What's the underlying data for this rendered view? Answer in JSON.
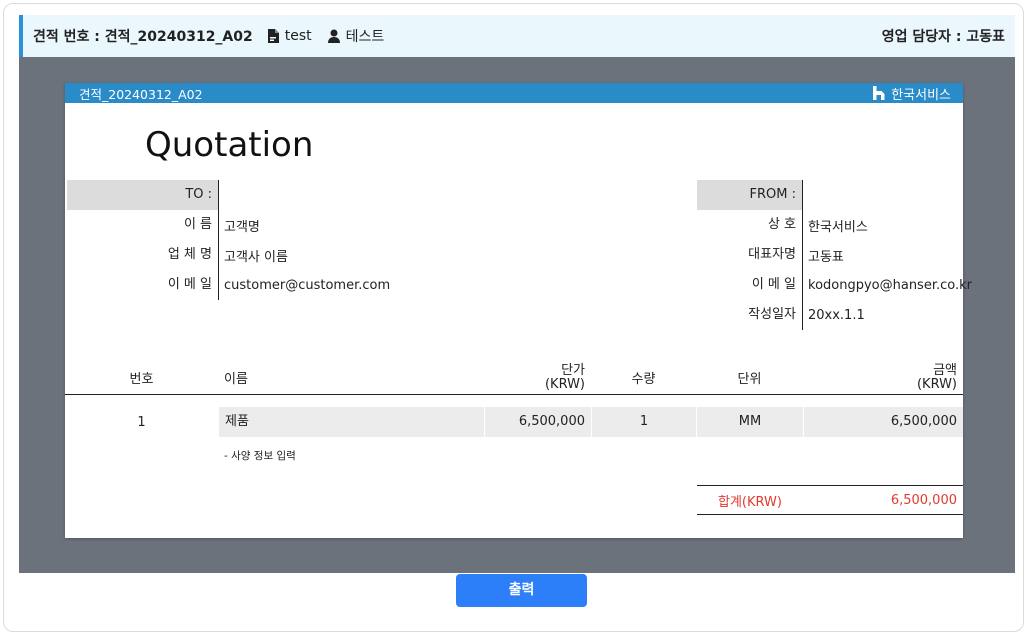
{
  "header": {
    "title": "견적 번호 : 견적_20240312_A02",
    "file_label": "test",
    "user_label": "테스트",
    "manager": "영업 담당자 : 고동표"
  },
  "doc": {
    "id": "견적_20240312_A02",
    "brand": "한국서비스",
    "title": "Quotation",
    "to": {
      "heading": "TO :",
      "rows": [
        {
          "label": "이 름",
          "value": "고객명"
        },
        {
          "label": "업 체 명",
          "value": "고객사 이름"
        },
        {
          "label": "이 메 일",
          "value": "customer@customer.com"
        }
      ]
    },
    "from": {
      "heading": "FROM :",
      "rows": [
        {
          "label": "상 호",
          "value": "한국서비스"
        },
        {
          "label": "대표자명",
          "value": "고동표"
        },
        {
          "label": "이 메 일",
          "value": "kodongpyo@hanser.co.kr"
        },
        {
          "label": "작성일자",
          "value": "20xx.1.1"
        }
      ]
    },
    "columns": {
      "no": "번호",
      "name": "이름",
      "price": "단가",
      "price_unit": "(KRW)",
      "qty": "수량",
      "unit": "단위",
      "amount": "금액",
      "amount_unit": "(KRW)"
    },
    "items": [
      {
        "no": "1",
        "name": "제품",
        "price": "6,500,000",
        "qty": "1",
        "unit": "MM",
        "amount": "6,500,000",
        "spec": "- 사양 정보 입력"
      }
    ],
    "total_label": "합계(KRW)",
    "total_value": "6,500,000"
  },
  "actions": {
    "print": "출력"
  },
  "colors": {
    "accent": "#2a8bc9",
    "button": "#2d7ff9",
    "total": "#e03a2e",
    "stage": "#6c727b"
  }
}
